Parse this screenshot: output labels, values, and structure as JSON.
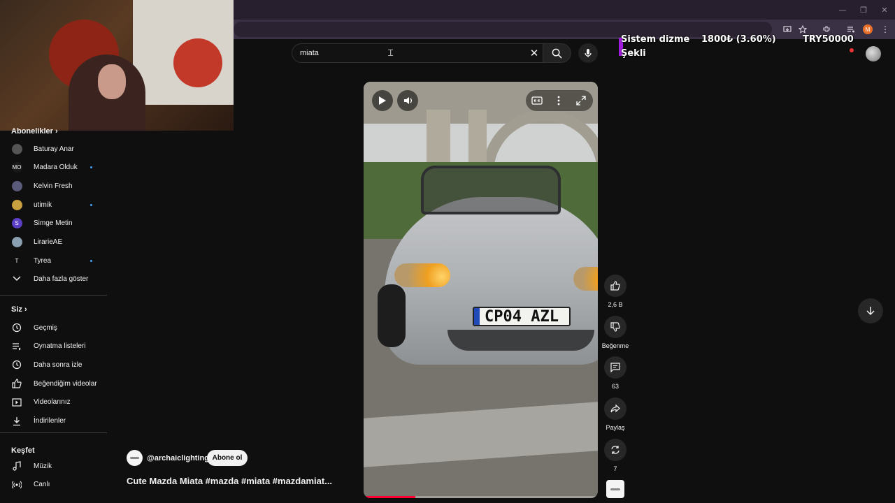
{
  "window_controls": {
    "minimize": "—",
    "maximize": "❐",
    "close": "✕"
  },
  "ticker": {
    "label_line1": "Sistem dizme",
    "label_line2": "Şekli",
    "amount": "1800₺ (3.60%)",
    "goal": "TRY50000"
  },
  "search": {
    "query": "miata"
  },
  "sidebar": {
    "subscriptions_heading": "Abonelikler",
    "channels": [
      {
        "name": "Baturay Anar",
        "avatar_color": "#555555",
        "initial": "",
        "new": false
      },
      {
        "name": "Madara Olduk",
        "avatar_color": "#1a1a1a",
        "initial": "MO",
        "new": true
      },
      {
        "name": "Kelvin Fresh",
        "avatar_color": "#5a5a7a",
        "initial": "",
        "new": false
      },
      {
        "name": "utimik",
        "avatar_color": "#c8a040",
        "initial": "",
        "new": true
      },
      {
        "name": "Simge Metin",
        "avatar_color": "#5b3fc4",
        "initial": "S",
        "new": false
      },
      {
        "name": "LirarieAE",
        "avatar_color": "#8aa0b0",
        "initial": "",
        "new": false
      },
      {
        "name": "Tyrea",
        "avatar_color": "#0f0f0f",
        "initial": "T",
        "new": true
      }
    ],
    "show_more": "Daha fazla göster",
    "you_heading": "Siz",
    "you_items": [
      {
        "label": "Geçmiş",
        "icon": "history-icon"
      },
      {
        "label": "Oynatma listeleri",
        "icon": "playlist-icon"
      },
      {
        "label": "Daha sonra izle",
        "icon": "watch-later-icon"
      },
      {
        "label": "Beğendiğim videolar",
        "icon": "liked-icon"
      },
      {
        "label": "Videolarınız",
        "icon": "your-videos-icon"
      },
      {
        "label": "İndirilenler",
        "icon": "download-icon"
      }
    ],
    "explore_heading": "Keşfet",
    "explore_items": [
      {
        "label": "Müzik",
        "icon": "music-icon"
      },
      {
        "label": "Canlı",
        "icon": "live-icon"
      }
    ]
  },
  "video": {
    "plate": "CP04 AZL",
    "progress": 0.22
  },
  "channel": {
    "handle": "@archaiclighting",
    "subscribe_label": "Abone ol"
  },
  "title": "Cute Mazda Miata #mazda #miata #mazdamiat...",
  "actions": {
    "likes": "2,6 B",
    "dislike": "Beğenme",
    "comments": "63",
    "share": "Paylaş",
    "remix": "7"
  },
  "colors": {
    "accent": "#ff0033",
    "ticker_accent": "#a21be0",
    "link_dot": "#3ea6ff",
    "profile": "#e8702a"
  }
}
